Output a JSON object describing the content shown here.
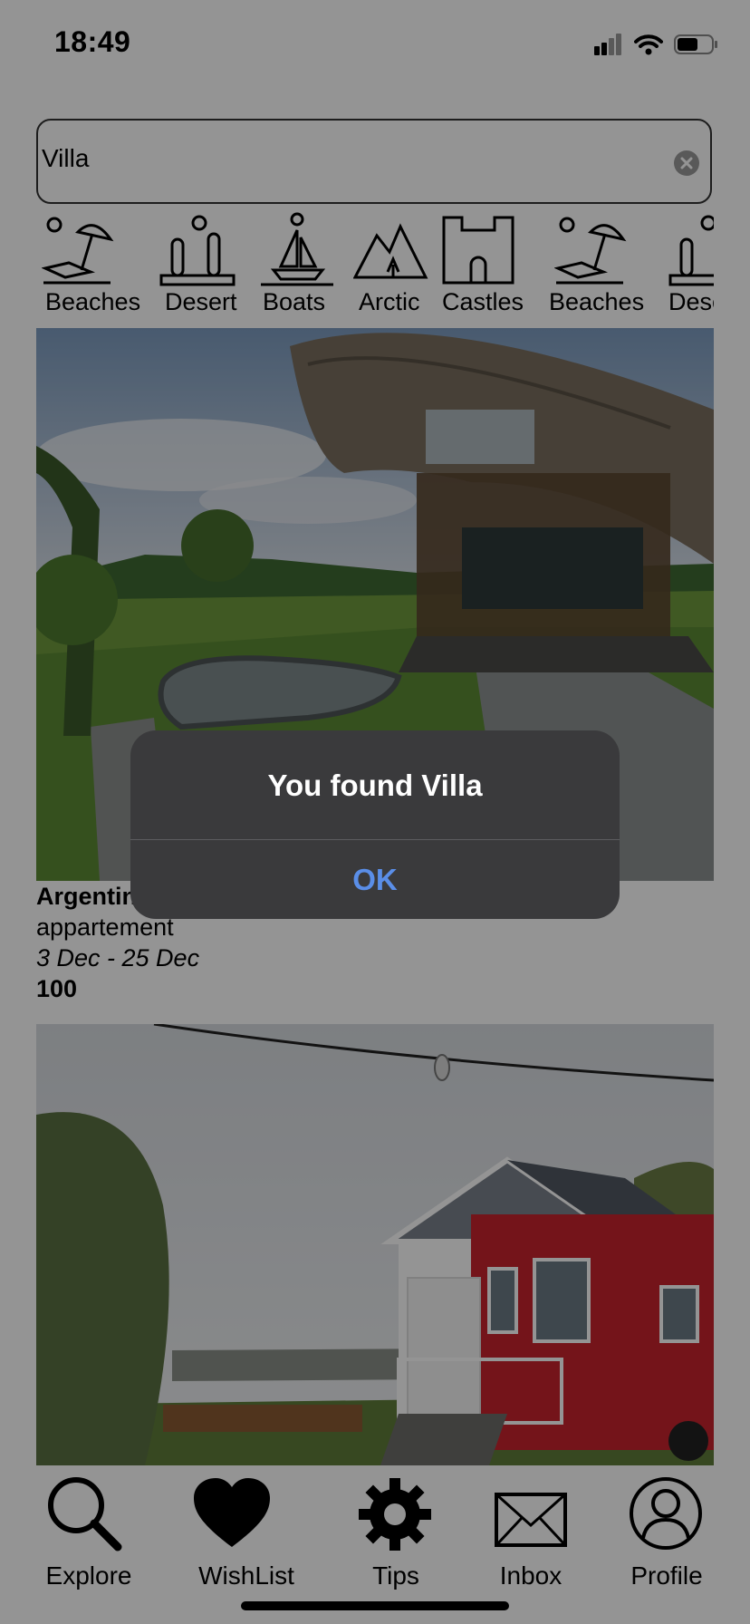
{
  "status_bar": {
    "time": "18:49"
  },
  "search": {
    "value": "Villa"
  },
  "categories": [
    {
      "label": "Beaches",
      "icon": "beach-umbrella-icon"
    },
    {
      "label": "Desert",
      "icon": "cactus-icon"
    },
    {
      "label": "Boats",
      "icon": "sailboat-icon"
    },
    {
      "label": "Arctic",
      "icon": "mountain-icon"
    },
    {
      "label": "Castles",
      "icon": "castle-icon"
    },
    {
      "label": "Beaches",
      "icon": "beach-umbrella-icon"
    },
    {
      "label": "Desert",
      "icon": "cactus-icon"
    }
  ],
  "listings": [
    {
      "title": "Argentina",
      "type": "appartement",
      "dates": "3 Dec - 25 Dec",
      "price": "100"
    }
  ],
  "tabbar": [
    {
      "label": "Explore",
      "icon": "magnifier-icon"
    },
    {
      "label": "WishList",
      "icon": "heart-icon"
    },
    {
      "label": "Tips",
      "icon": "gear-icon"
    },
    {
      "label": "Inbox",
      "icon": "envelope-icon"
    },
    {
      "label": "Profile",
      "icon": "person-icon"
    }
  ],
  "alert": {
    "title": "You found Villa",
    "ok_label": "OK"
  },
  "colors": {
    "alert_bg": "#3a3a3c",
    "alert_button": "#5a8ee8",
    "overlay": "rgba(0,0,0,0.42)"
  }
}
